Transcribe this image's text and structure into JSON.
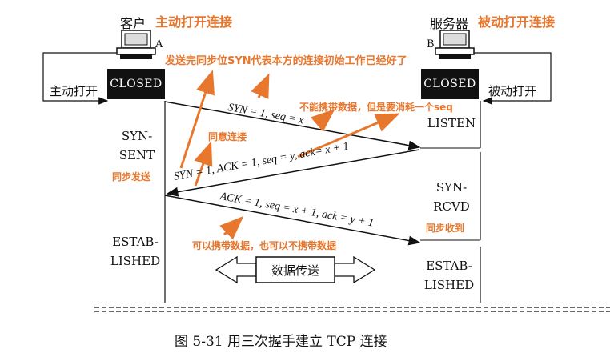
{
  "client": {
    "label": "客户",
    "note": "主动打开连接",
    "id": "A",
    "active_open": "主动打开",
    "state_closed": "CLOSED",
    "state_syn_sent": [
      "SYN-",
      "SENT"
    ],
    "state_established": [
      "ESTAB-",
      "LISHED"
    ]
  },
  "server": {
    "label": "服务器",
    "note": "被动打开连接",
    "id": "B",
    "passive_open": "被动打开",
    "state_closed": "CLOSED",
    "state_listen": "LISTEN",
    "state_syn_rcvd": [
      "SYN-",
      "RCVD"
    ],
    "state_established": [
      "ESTAB-",
      "LISHED"
    ]
  },
  "messages": {
    "m1": "SYN = 1, seq = x",
    "m2": "SYN = 1, ACK = 1, seq = y, ack= x + 1",
    "m3": "ACK = 1, seq = x + 1, ack = y + 1"
  },
  "annotations": {
    "syn_meaning": "发送完同步位SYN代表本方的连接初始工作已经好了",
    "no_data": "不能携带数据，但是要消耗一个seq",
    "agree": "同意连接",
    "sync_send": "同步发送",
    "sync_recv": "同步收到",
    "ack_data": "可以携带数据，也可以不携带数据"
  },
  "data_transfer": "数据传送",
  "caption": "图 5-31 用三次握手建立 TCP 连接",
  "colors": {
    "annotation": "#e8772e",
    "state_box": "#111111"
  }
}
